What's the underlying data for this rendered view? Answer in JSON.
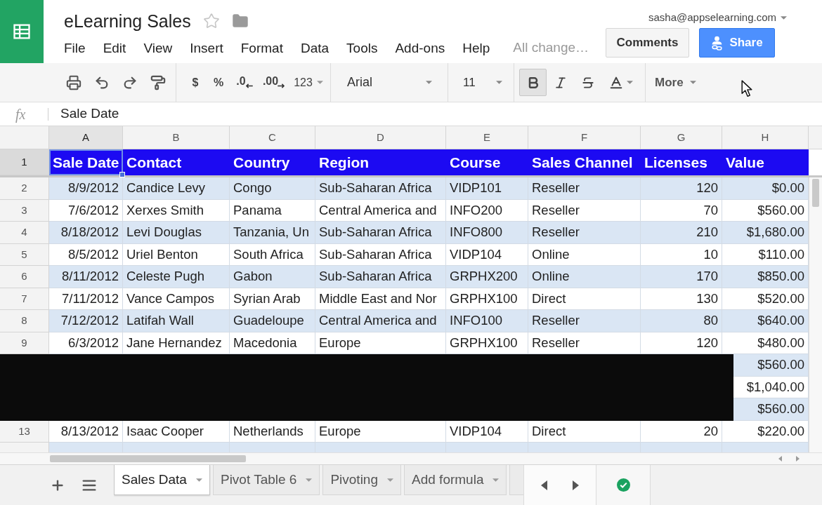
{
  "header": {
    "title": "eLearning Sales",
    "starred": false,
    "menu": [
      "File",
      "Edit",
      "View",
      "Insert",
      "Format",
      "Data",
      "Tools",
      "Add-ons",
      "Help"
    ],
    "save_status": "All change…",
    "account": "sasha@appselearning.com",
    "comments_button": "Comments",
    "share_button": "Share"
  },
  "toolbar": {
    "currency": "$",
    "percent": "%",
    "decrease_decimals": ".0",
    "increase_decimals": ".00",
    "number_format": "123",
    "font": "Arial",
    "font_size": "11",
    "bold": true,
    "italic": false,
    "strikethrough": false,
    "more": "More"
  },
  "formula_bar": {
    "label": "fx",
    "value": "Sale Date"
  },
  "sheet": {
    "columns": [
      {
        "letter": "A",
        "selected": true
      },
      {
        "letter": "B",
        "selected": false
      },
      {
        "letter": "C",
        "selected": false
      },
      {
        "letter": "D",
        "selected": false
      },
      {
        "letter": "E",
        "selected": false
      },
      {
        "letter": "F",
        "selected": false
      },
      {
        "letter": "G",
        "selected": false
      },
      {
        "letter": "H",
        "selected": false
      }
    ],
    "rows": [
      {
        "kind": "header",
        "number": "1",
        "selected": true,
        "cells": [
          "Sale Date",
          "Contact",
          "Country",
          "Region",
          "Course",
          "Sales Channel",
          "Licenses",
          "Value"
        ]
      },
      {
        "kind": "data",
        "number": "2",
        "selected": false,
        "cells": [
          "8/9/2012",
          "Candice Levy",
          "Congo",
          "Sub-Saharan Africa",
          "VIDP101",
          "Reseller",
          "120",
          "$0.00"
        ]
      },
      {
        "kind": "data",
        "number": "3",
        "selected": false,
        "cells": [
          "7/6/2012",
          "Xerxes Smith",
          "Panama",
          "Central America and",
          "INFO200",
          "Reseller",
          "70",
          "$560.00"
        ]
      },
      {
        "kind": "data",
        "number": "4",
        "selected": false,
        "cells": [
          "8/18/2012",
          "Levi Douglas",
          "Tanzania, Un",
          "Sub-Saharan Africa",
          "INFO800",
          "Reseller",
          "210",
          "$1,680.00"
        ]
      },
      {
        "kind": "data",
        "number": "5",
        "selected": false,
        "cells": [
          "8/5/2012",
          "Uriel Benton",
          "South Africa",
          "Sub-Saharan Africa",
          "VIDP104",
          "Online",
          "10",
          "$110.00"
        ]
      },
      {
        "kind": "data",
        "number": "6",
        "selected": false,
        "cells": [
          "8/11/2012",
          "Celeste Pugh",
          "Gabon",
          "Sub-Saharan Africa",
          "GRPHX200",
          "Online",
          "170",
          "$850.00"
        ]
      },
      {
        "kind": "data",
        "number": "7",
        "selected": false,
        "cells": [
          "7/11/2012",
          "Vance Campos",
          "Syrian Arab",
          "Middle East and Nor",
          "GRPHX100",
          "Direct",
          "130",
          "$520.00"
        ]
      },
      {
        "kind": "data",
        "number": "8",
        "selected": false,
        "cells": [
          "7/12/2012",
          "Latifah Wall",
          "Guadeloupe",
          "Central America and",
          "INFO100",
          "Reseller",
          "80",
          "$640.00"
        ]
      },
      {
        "kind": "data",
        "number": "9",
        "selected": false,
        "cells": [
          "6/3/2012",
          "Jane Hernandez",
          "Macedonia",
          "Europe",
          "GRPHX100",
          "Reseller",
          "120",
          "$480.00"
        ]
      },
      {
        "kind": "covered",
        "value": "$560.00"
      },
      {
        "kind": "covered",
        "value": "$1,040.00"
      },
      {
        "kind": "covered",
        "value": "$560.00"
      },
      {
        "kind": "data",
        "number": "13",
        "selected": false,
        "cells": [
          "8/13/2012",
          "Isaac Cooper",
          "Netherlands",
          "Europe",
          "VIDP104",
          "Direct",
          "20",
          "$220.00"
        ]
      }
    ]
  },
  "sheet_tabs": [
    {
      "label": "Sales Data",
      "selected": true
    },
    {
      "label": "Pivot Table 6",
      "selected": false
    },
    {
      "label": "Pivoting",
      "selected": false
    },
    {
      "label": "Add formula",
      "selected": false
    }
  ]
}
